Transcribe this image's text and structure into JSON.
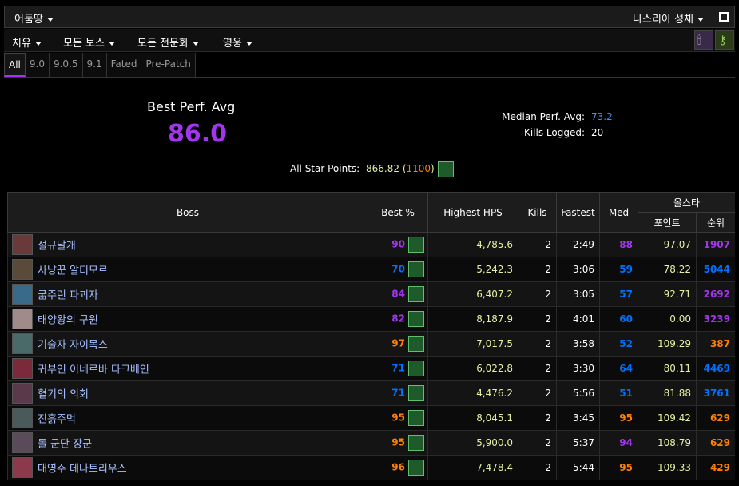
{
  "topbar": {
    "character": "어둠땅",
    "zone": "나스리아 성채"
  },
  "filters": {
    "role": "치유",
    "boss": "모든 보스",
    "spec": "모든 전문화",
    "difficulty": "영웅"
  },
  "icons": {
    "raid": "raid-icon",
    "key": "key-icon"
  },
  "tabs": [
    "All",
    "9.0",
    "9.0.5",
    "9.1",
    "Fated",
    "Pre-Patch"
  ],
  "active_tab": "All",
  "summary": {
    "best_label": "Best Perf. Avg",
    "best_value": "86.0",
    "median_label": "Median Perf. Avg:",
    "median_value": "73.2",
    "kills_label": "Kills Logged:",
    "kills_value": "20",
    "star_label": "All Star Points:",
    "star_value": "866.82",
    "star_max": "1100"
  },
  "table": {
    "headers": {
      "boss": "Boss",
      "best": "Best %",
      "hps": "Highest HPS",
      "kills": "Kills",
      "fastest": "Fastest",
      "med": "Med",
      "allstar": "올스타",
      "points": "포인트",
      "rank": "순위"
    },
    "rows": [
      {
        "boss": "절규날개",
        "best": "90",
        "hps": "4,785.6",
        "kills": "2",
        "fastest": "2:49",
        "med": "88",
        "points": "97.07",
        "rank": "1907",
        "best_color": "#a335ee",
        "med_color": "#a335ee",
        "rank_color": "#a335ee",
        "portrait_color": "#6a3a3a"
      },
      {
        "boss": "사냥꾼 알티모르",
        "best": "70",
        "hps": "5,242.3",
        "kills": "2",
        "fastest": "3:06",
        "med": "59",
        "points": "78.22",
        "rank": "5044",
        "best_color": "#0070ff",
        "med_color": "#0070ff",
        "rank_color": "#0070ff",
        "portrait_color": "#5a4a3a"
      },
      {
        "boss": "굶주린 파괴자",
        "best": "84",
        "hps": "6,407.2",
        "kills": "2",
        "fastest": "3:05",
        "med": "57",
        "points": "92.71",
        "rank": "2692",
        "best_color": "#a335ee",
        "med_color": "#0070ff",
        "rank_color": "#a335ee",
        "portrait_color": "#3a6a8a"
      },
      {
        "boss": "태양왕의 구원",
        "best": "82",
        "hps": "8,187.9",
        "kills": "2",
        "fastest": "4:01",
        "med": "60",
        "points": "0.00",
        "rank": "3239",
        "best_color": "#a335ee",
        "med_color": "#0070ff",
        "rank_color": "#a335ee",
        "portrait_color": "#a08a8a"
      },
      {
        "boss": "기술자 자이목스",
        "best": "97",
        "hps": "7,017.5",
        "kills": "2",
        "fastest": "3:58",
        "med": "52",
        "points": "109.29",
        "rank": "387",
        "best_color": "#ff8000",
        "med_color": "#0070ff",
        "rank_color": "#ff8000",
        "portrait_color": "#4a6a6a"
      },
      {
        "boss": "귀부인 이네르바 다크베인",
        "best": "71",
        "hps": "6,022.8",
        "kills": "2",
        "fastest": "3:30",
        "med": "64",
        "points": "80.11",
        "rank": "4469",
        "best_color": "#0070ff",
        "med_color": "#0070ff",
        "rank_color": "#0070ff",
        "portrait_color": "#7a2a3a"
      },
      {
        "boss": "혈기의 의회",
        "best": "71",
        "hps": "4,476.2",
        "kills": "2",
        "fastest": "5:56",
        "med": "51",
        "points": "81.88",
        "rank": "3761",
        "best_color": "#0070ff",
        "med_color": "#0070ff",
        "rank_color": "#0070ff",
        "portrait_color": "#5a3a4a"
      },
      {
        "boss": "진흙주먹",
        "best": "95",
        "hps": "8,045.1",
        "kills": "2",
        "fastest": "3:45",
        "med": "95",
        "points": "109.42",
        "rank": "629",
        "best_color": "#ff8000",
        "med_color": "#ff8000",
        "rank_color": "#ff8000",
        "portrait_color": "#4a5a5a"
      },
      {
        "boss": "돌 군단 장군",
        "best": "95",
        "hps": "5,900.0",
        "kills": "2",
        "fastest": "5:37",
        "med": "94",
        "points": "108.79",
        "rank": "629",
        "best_color": "#ff8000",
        "med_color": "#a335ee",
        "rank_color": "#ff8000",
        "portrait_color": "#5a4a5a"
      },
      {
        "boss": "대영주 데나트리우스",
        "best": "96",
        "hps": "7,478.4",
        "kills": "2",
        "fastest": "5:44",
        "med": "95",
        "points": "109.33",
        "rank": "429",
        "best_color": "#ff8000",
        "med_color": "#ff8000",
        "rank_color": "#ff8000",
        "portrait_color": "#8a3a4a"
      }
    ]
  }
}
